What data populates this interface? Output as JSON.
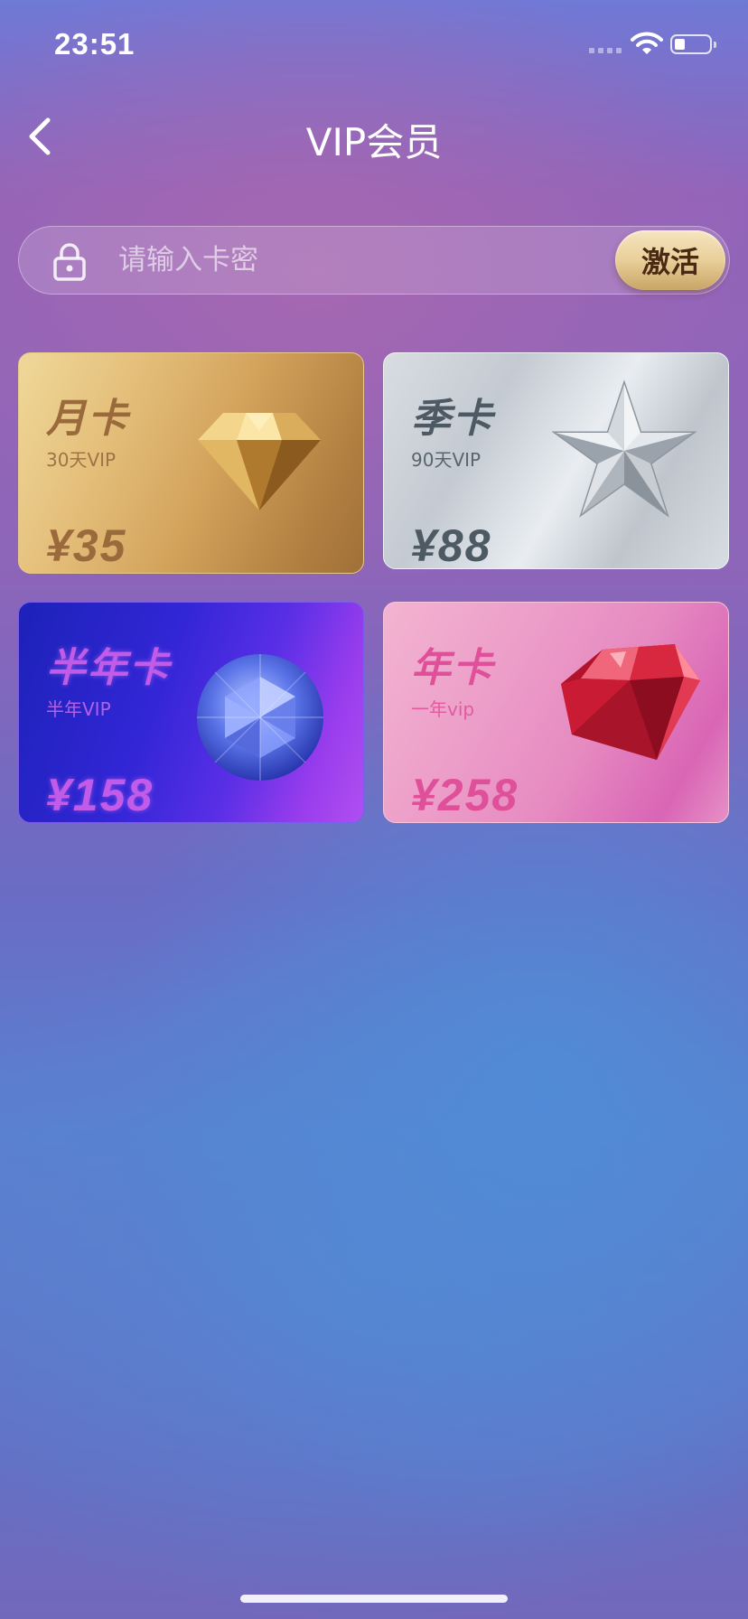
{
  "status_bar": {
    "time": "23:51"
  },
  "header": {
    "title": "VIP会员"
  },
  "activation": {
    "placeholder": "请输入卡密",
    "button_label": "激活"
  },
  "cards": [
    {
      "name": "月卡",
      "subtitle": "30天VIP",
      "price": "¥35",
      "gem": "gold-diamond-icon"
    },
    {
      "name": "季卡",
      "subtitle": "90天VIP",
      "price": "¥88",
      "gem": "silver-star-icon"
    },
    {
      "name": "半年卡",
      "subtitle": "半年VIP",
      "price": "¥158",
      "gem": "blue-gem-icon"
    },
    {
      "name": "年卡",
      "subtitle": "一年vip",
      "price": "¥258",
      "gem": "ruby-gem-icon"
    }
  ],
  "colors": {
    "accent_gold": "#e9cf9a",
    "title": "#ffffff"
  }
}
